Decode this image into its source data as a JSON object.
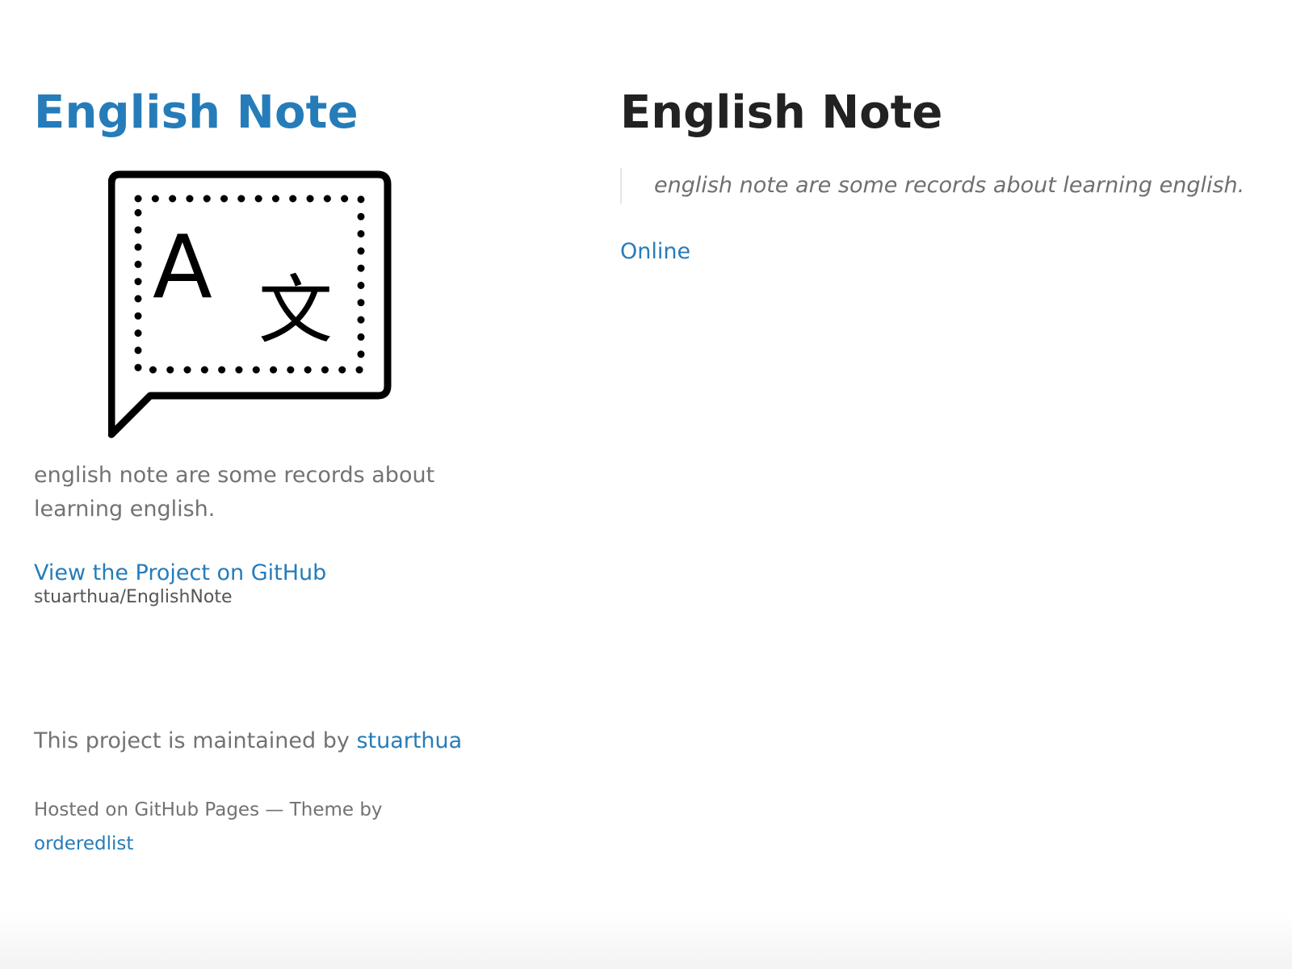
{
  "header": {
    "title": "English Note",
    "logo_icon": "translate-speech-bubble-icon",
    "description": "english note are some records about learning english.",
    "project_link": {
      "label": "View the Project on GitHub",
      "repo": "stuarthua/EnglishNote"
    },
    "logo_glyphs": {
      "latin": "A",
      "cjk": "文"
    }
  },
  "footer": {
    "maintained_prefix": "This project is maintained by ",
    "maintainer": "stuarthua",
    "hosted_text": "Hosted on GitHub Pages — Theme by ",
    "theme_author": "orderedlist"
  },
  "main": {
    "title": "English Note",
    "quote": "english note are some records about learning english.",
    "links": [
      {
        "label": "Online"
      }
    ]
  },
  "colors": {
    "link": "#267CB9",
    "heading": "#222222",
    "body_text": "#727272",
    "background": "#ffffff"
  }
}
